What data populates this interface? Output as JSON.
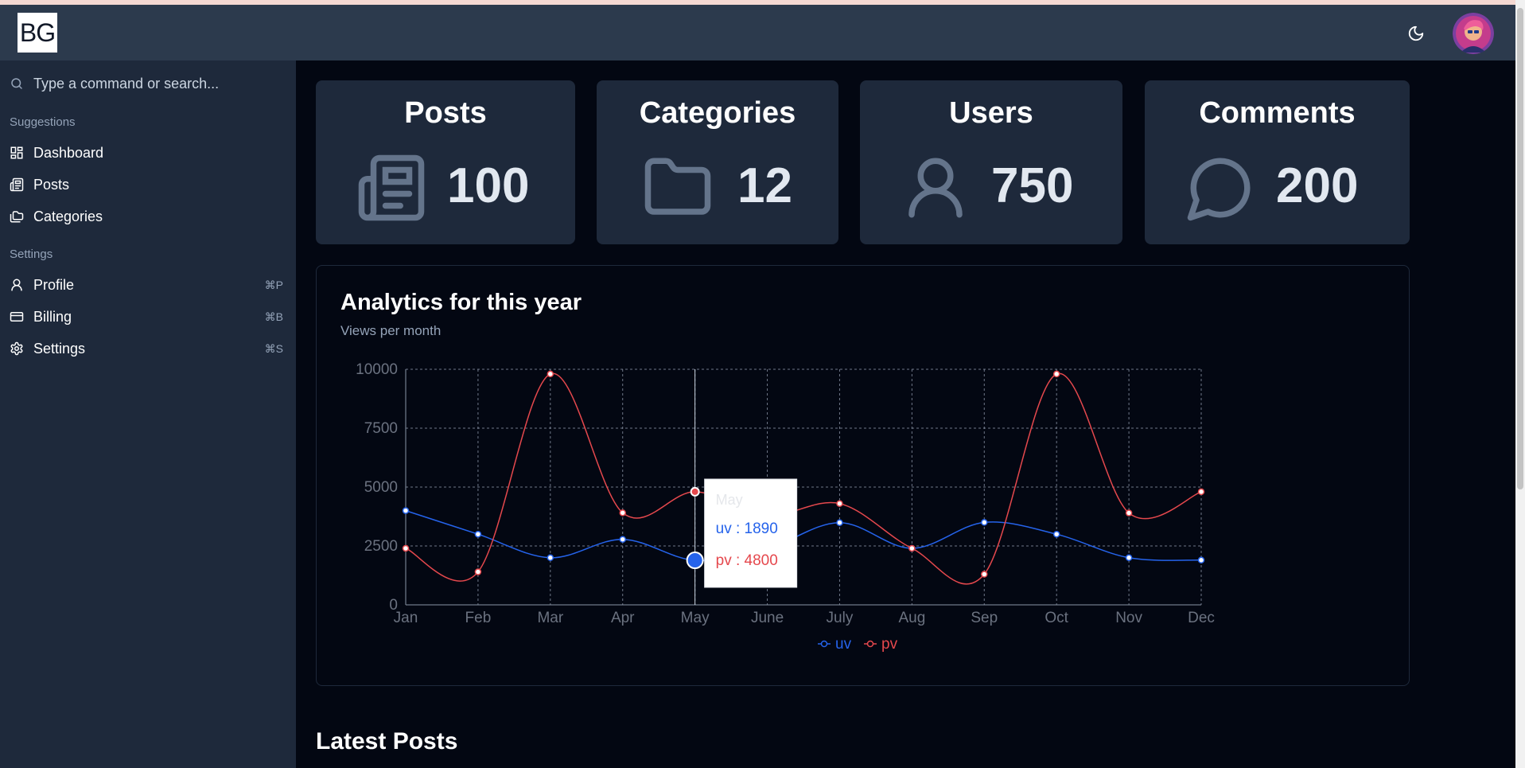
{
  "navbar": {
    "logo_text": "BG",
    "theme_icon": "moon-icon",
    "avatar_icon": "user-avatar"
  },
  "sidebar": {
    "search": {
      "placeholder": "Type a command or search...",
      "icon": "search-icon"
    },
    "groups": [
      {
        "label": "Suggestions",
        "items": [
          {
            "label": "Dashboard",
            "icon": "dashboard-icon",
            "shortcut": ""
          },
          {
            "label": "Posts",
            "icon": "newspaper-icon",
            "shortcut": ""
          },
          {
            "label": "Categories",
            "icon": "folders-icon",
            "shortcut": ""
          }
        ]
      },
      {
        "label": "Settings",
        "items": [
          {
            "label": "Profile",
            "icon": "user-icon",
            "shortcut": "⌘P"
          },
          {
            "label": "Billing",
            "icon": "credit-card-icon",
            "shortcut": "⌘B"
          },
          {
            "label": "Settings",
            "icon": "gear-icon",
            "shortcut": "⌘S"
          }
        ]
      }
    ]
  },
  "stats": [
    {
      "title": "Posts",
      "value": "100",
      "icon": "newspaper-icon"
    },
    {
      "title": "Categories",
      "value": "12",
      "icon": "folder-icon"
    },
    {
      "title": "Users",
      "value": "750",
      "icon": "user-icon"
    },
    {
      "title": "Comments",
      "value": "200",
      "icon": "message-circle-icon"
    }
  ],
  "analytics": {
    "title": "Analytics for this year",
    "subtitle": "Views per month"
  },
  "chart_data": {
    "type": "line",
    "categories": [
      "Jan",
      "Feb",
      "Mar",
      "Apr",
      "May",
      "June",
      "July",
      "Aug",
      "Sep",
      "Oct",
      "Nov",
      "Dec"
    ],
    "series": [
      {
        "name": "uv",
        "color": "#2563eb",
        "values": [
          4000,
          3000,
          2000,
          2780,
          1890,
          2390,
          3490,
          2400,
          3500,
          3000,
          2000,
          1900
        ]
      },
      {
        "name": "pv",
        "color": "#e5484d",
        "values": [
          2400,
          1400,
          9800,
          3908,
          4800,
          3800,
          4300,
          2400,
          1300,
          9800,
          3900,
          4800
        ]
      }
    ],
    "yticks": [
      0,
      2500,
      5000,
      7500,
      10000
    ],
    "ylim": [
      0,
      10000
    ],
    "grid": true,
    "legend": "bottom-center",
    "tooltip": {
      "category": "May",
      "lines": [
        "uv : 1890",
        "pv : 4800"
      ]
    }
  },
  "latest_posts": {
    "title": "Latest Posts"
  }
}
